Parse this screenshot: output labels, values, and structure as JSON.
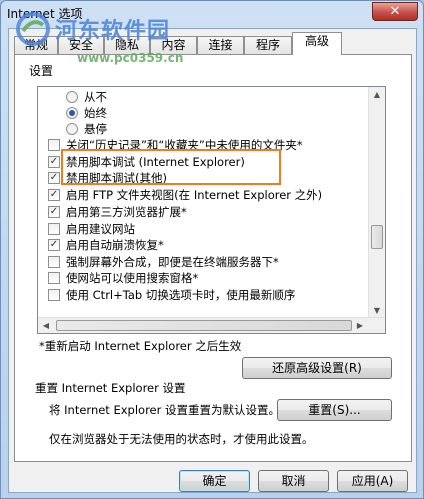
{
  "window": {
    "title": "Internet 选项",
    "close_glyph": "✕"
  },
  "watermark": {
    "line1": "河东软件园",
    "line2": "www.pc0359.cn"
  },
  "tabs": [
    {
      "label": "常规"
    },
    {
      "label": "安全"
    },
    {
      "label": "隐私"
    },
    {
      "label": "内容"
    },
    {
      "label": "连接"
    },
    {
      "label": "程序"
    },
    {
      "label": "高级",
      "active": true
    }
  ],
  "settings": {
    "group_label": "设置",
    "items": [
      {
        "kind": "radio",
        "label": "从不",
        "checked": false,
        "indent": 1
      },
      {
        "kind": "radio",
        "label": "始终",
        "checked": true,
        "indent": 1
      },
      {
        "kind": "radio",
        "label": "悬停",
        "checked": false,
        "indent": 1
      },
      {
        "kind": "checkbox",
        "label": "关闭“历史记录”和“收藏夹”中未使用的文件夹*",
        "checked": false
      },
      {
        "kind": "checkbox",
        "label": "禁用脚本调试 (Internet Explorer)",
        "checked": true
      },
      {
        "kind": "checkbox",
        "label": "禁用脚本调试(其他)",
        "checked": true
      },
      {
        "kind": "checkbox",
        "label": "启用 FTP 文件夹视图(在 Internet Explorer 之外)",
        "checked": true
      },
      {
        "kind": "checkbox",
        "label": "启用第三方浏览器扩展*",
        "checked": true
      },
      {
        "kind": "checkbox",
        "label": "启用建议网站",
        "checked": false
      },
      {
        "kind": "checkbox",
        "label": "启用自动崩溃恢复*",
        "checked": true
      },
      {
        "kind": "checkbox",
        "label": "强制屏幕外合成，即便是在终端服务器下*",
        "checked": false
      },
      {
        "kind": "checkbox",
        "label": "使网站可以使用搜索窗格*",
        "checked": false
      },
      {
        "kind": "checkbox",
        "label": "使用 Ctrl+Tab 切换选项卡时，使用最新顺序",
        "checked": false
      }
    ],
    "check_glyph": "✓"
  },
  "restart_note": "*重新启动 Internet Explorer 之后生效",
  "restore_button": "还原高级设置(R)",
  "reset": {
    "heading": "重置 Internet Explorer 设置",
    "description": "将 Internet Explorer 设置重置为默认设置。",
    "button": "重置(S)...",
    "note": "仅在浏览器处于无法使用的状态时，才使用此设置。"
  },
  "dialog_buttons": {
    "ok": "确定",
    "cancel": "取消",
    "apply": "应用(A)"
  }
}
